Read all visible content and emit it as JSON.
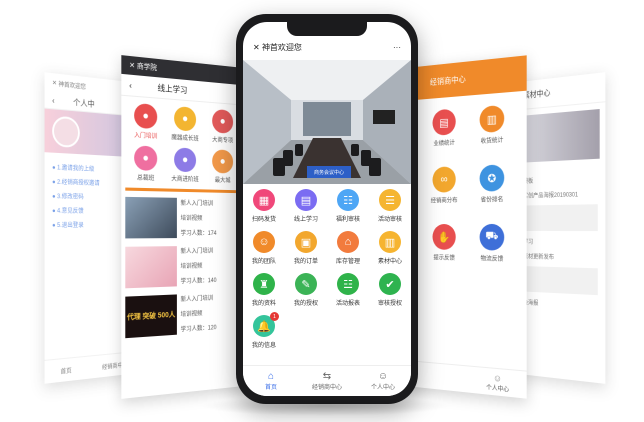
{
  "far_left": {
    "header": "神首欢迎您",
    "title": "个人中",
    "items": [
      "1.邀请我的上级",
      "2.经销商授权邀请",
      "3.修改密码",
      "4.意见反馈",
      "5.退出登录"
    ],
    "tabs": [
      "首页",
      "经销商中心"
    ]
  },
  "left": {
    "header": "商学院",
    "title": "线上学习",
    "icons": [
      "入门培训",
      "魔器成长班",
      "大商专项",
      "总裁班",
      "大商进阶班",
      "最大城"
    ],
    "list": [
      {
        "title": "新人入门培训",
        "sub": "培训视频",
        "count": "学习人数：174"
      },
      {
        "title": "新人入门培训",
        "sub": "培训视频",
        "count": "学习人数：140"
      },
      {
        "title": "新人入门培训",
        "sub": "培训视频",
        "count": "学习人数：120"
      }
    ],
    "banner_text": "代理 突破 500人"
  },
  "right": {
    "header": "经销商中心",
    "icons": [
      "业绩统计",
      "收货统计",
      "经销商分布",
      "省份排名",
      "提示反馈",
      "物流反馈"
    ],
    "tabs": [
      "个人中心"
    ]
  },
  "far_right": {
    "title": "素材中心",
    "items": [
      "素材模板",
      "美丽实创产品海报20190301",
      "新人学习",
      "颜神素材更新发布",
      "实体会海报"
    ]
  },
  "phone": {
    "header_title": "神首欢迎您",
    "close": "✕",
    "more": "···",
    "banner_sign": "商务会议中心",
    "grid": [
      {
        "label": "扫码发货",
        "color": "#f0487a",
        "glyph": "▦",
        "icon": "scan-icon"
      },
      {
        "label": "线上学习",
        "color": "#7b6cf2",
        "glyph": "▤",
        "icon": "book-icon"
      },
      {
        "label": "福利审核",
        "color": "#4ea6f5",
        "glyph": "☷",
        "icon": "audit-icon"
      },
      {
        "label": "活动审核",
        "color": "#f5b531",
        "glyph": "☰",
        "icon": "activity-icon"
      },
      {
        "label": "我的团队",
        "color": "#f08a2a",
        "glyph": "☺",
        "icon": "team-icon"
      },
      {
        "label": "我的订单",
        "color": "#f2a72e",
        "glyph": "▣",
        "icon": "order-icon"
      },
      {
        "label": "库存管理",
        "color": "#f27b3d",
        "glyph": "⌂",
        "icon": "stock-icon"
      },
      {
        "label": "素材中心",
        "color": "#f6b430",
        "glyph": "▥",
        "icon": "material-icon"
      },
      {
        "label": "我的资料",
        "color": "#2fb34a",
        "glyph": "♜",
        "icon": "profile-icon"
      },
      {
        "label": "我的授权",
        "color": "#3bb356",
        "glyph": "✎",
        "icon": "license-icon"
      },
      {
        "label": "活动报表",
        "color": "#2fb34a",
        "glyph": "☳",
        "icon": "report-icon"
      },
      {
        "label": "审核授权",
        "color": "#2eb34f",
        "glyph": "✔",
        "icon": "approve-icon"
      },
      {
        "label": "我的信息",
        "color": "#34c49b",
        "glyph": "🔔",
        "icon": "bell-icon"
      }
    ],
    "badge": "1",
    "tabs": [
      {
        "label": "首页",
        "glyph": "⌂",
        "icon": "home-icon"
      },
      {
        "label": "经销商中心",
        "glyph": "⇆",
        "icon": "dealer-icon"
      },
      {
        "label": "个人中心",
        "glyph": "☺",
        "icon": "user-icon"
      }
    ]
  }
}
